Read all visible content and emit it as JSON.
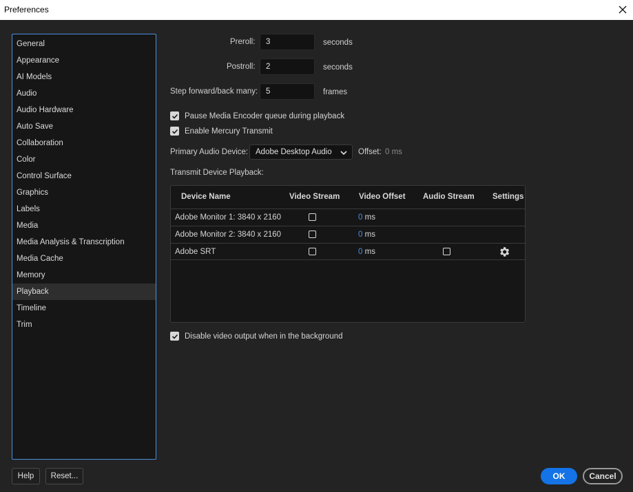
{
  "window": {
    "title": "Preferences"
  },
  "sidebar": {
    "items": [
      {
        "label": "General"
      },
      {
        "label": "Appearance"
      },
      {
        "label": "AI Models"
      },
      {
        "label": "Audio"
      },
      {
        "label": "Audio Hardware"
      },
      {
        "label": "Auto Save"
      },
      {
        "label": "Collaboration"
      },
      {
        "label": "Color"
      },
      {
        "label": "Control Surface"
      },
      {
        "label": "Graphics"
      },
      {
        "label": "Labels"
      },
      {
        "label": "Media"
      },
      {
        "label": "Media Analysis & Transcription"
      },
      {
        "label": "Media Cache"
      },
      {
        "label": "Memory"
      },
      {
        "label": "Playback"
      },
      {
        "label": "Timeline"
      },
      {
        "label": "Trim"
      }
    ],
    "selected": "Playback"
  },
  "playback": {
    "preroll_label": "Preroll:",
    "preroll_value": "3",
    "preroll_unit": "seconds",
    "postroll_label": "Postroll:",
    "postroll_value": "2",
    "postroll_unit": "seconds",
    "step_label": "Step forward/back many:",
    "step_value": "5",
    "step_unit": "frames",
    "pause_encoder_label": "Pause Media Encoder queue during playback",
    "pause_encoder_checked": true,
    "mercury_label": "Enable Mercury Transmit",
    "mercury_checked": true,
    "audio_device_label": "Primary Audio Device:",
    "audio_device_value": "Adobe Desktop Audio",
    "offset_label": "Offset:",
    "offset_value": "0 ms",
    "transmit_label": "Transmit Device Playback:",
    "disable_output_label": "Disable video output when in the background",
    "disable_output_checked": true
  },
  "table": {
    "headers": {
      "device": "Device Name",
      "video_stream": "Video Stream",
      "video_offset": "Video Offset",
      "audio_stream": "Audio Stream",
      "settings": "Settings"
    },
    "rows": [
      {
        "name": "Adobe Monitor 1: 3840 x 2160",
        "offset": "0",
        "unit": "ms"
      },
      {
        "name": "Adobe Monitor 2: 3840 x 2160",
        "offset": "0",
        "unit": "ms"
      },
      {
        "name": "Adobe SRT",
        "offset": "0",
        "unit": "ms"
      }
    ]
  },
  "footer": {
    "help": "Help",
    "reset": "Reset...",
    "ok": "OK",
    "cancel": "Cancel"
  },
  "colors": {
    "accent": "#1473e6",
    "background": "#232323",
    "selection": "#4a8fe0"
  },
  "icons": {
    "close": "close-icon",
    "checkmark": "checkmark-icon",
    "chevron": "chevron-down-icon",
    "gear": "gear-icon"
  }
}
